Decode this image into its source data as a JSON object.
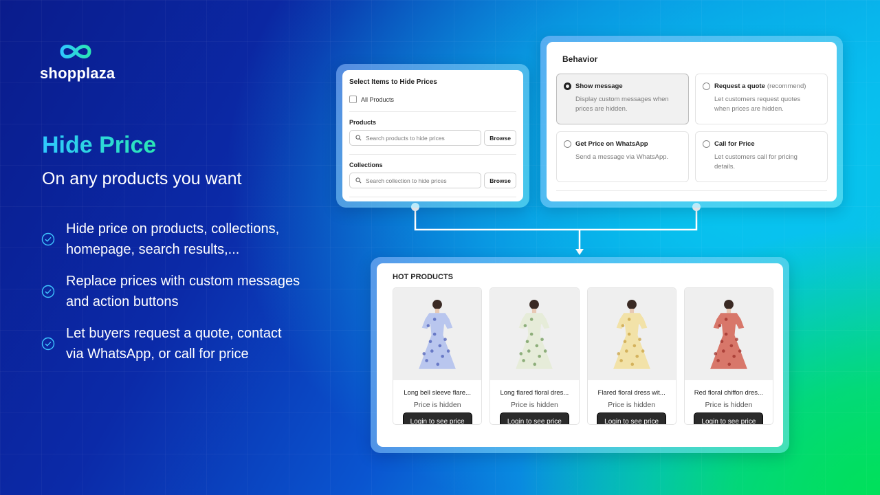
{
  "brand": {
    "name": "shopplaza"
  },
  "hero": {
    "title": "Hide Price",
    "subtitle": "On any products you want"
  },
  "features": [
    {
      "text": "Hide price on products, collections, homepage, search results,...",
      "line1": "Hide price on products, collections,",
      "line2": "homepage, search results,..."
    },
    {
      "text": "Replace prices with custom messages and action buttons",
      "line1": "Replace prices with custom messages",
      "line2": "and action buttons"
    },
    {
      "text": "Let buyers request a quote, contact via WhatsApp, or call for price",
      "line1": "Let buyers request a quote, contact",
      "line2": "via WhatsApp, or call for price"
    }
  ],
  "select_panel": {
    "title": "Select Items to Hide Prices",
    "all_products": "All Products",
    "products_label": "Products",
    "products_placeholder": "Search products to hide prices",
    "collections_label": "Collections",
    "collections_placeholder": "Search collection to hide prices",
    "browse": "Browse"
  },
  "behavior_panel": {
    "title": "Behavior",
    "options": [
      {
        "name": "Show message",
        "extra": "",
        "desc1": "Display custom messages when",
        "desc2": "prices are hidden.",
        "selected": true
      },
      {
        "name": "Request a quote",
        "extra": "(recommend)",
        "desc1": "Let customers request quotes",
        "desc2": "when prices are hidden.",
        "selected": false
      },
      {
        "name": "Get Price on WhatsApp",
        "extra": "",
        "desc1": "Send a message via WhatsApp.",
        "desc2": "",
        "selected": false
      },
      {
        "name": "Call for Price",
        "extra": "",
        "desc1": "Let customers call for pricing",
        "desc2": "details.",
        "selected": false
      }
    ]
  },
  "products_panel": {
    "title": "HOT PRODUCTS",
    "items": [
      {
        "name": "Long bell sleeve flare...",
        "price_text": "Price is hidden",
        "button": "Login to see price",
        "dress_color": "#b9c6ee",
        "pattern_color": "#4d5fb8"
      },
      {
        "name": "Long flared floral dres...",
        "price_text": "Price is hidden",
        "button": "Login to see price",
        "dress_color": "#e6ecd9",
        "pattern_color": "#6f9a5a"
      },
      {
        "name": "Flared floral dress wit...",
        "price_text": "Price is hidden",
        "button": "Login to see price",
        "dress_color": "#f2e2a8",
        "pattern_color": "#c9a243"
      },
      {
        "name": "Red floral chiffon dres...",
        "price_text": "Price is hidden",
        "button": "Login to see price",
        "dress_color": "#d8776a",
        "pattern_color": "#9e2f2a"
      }
    ]
  },
  "colors": {
    "accent_gradient_start": "#2fc8ff",
    "accent_gradient_end": "#2be6b4",
    "button_dark": "#2b2b2b"
  }
}
